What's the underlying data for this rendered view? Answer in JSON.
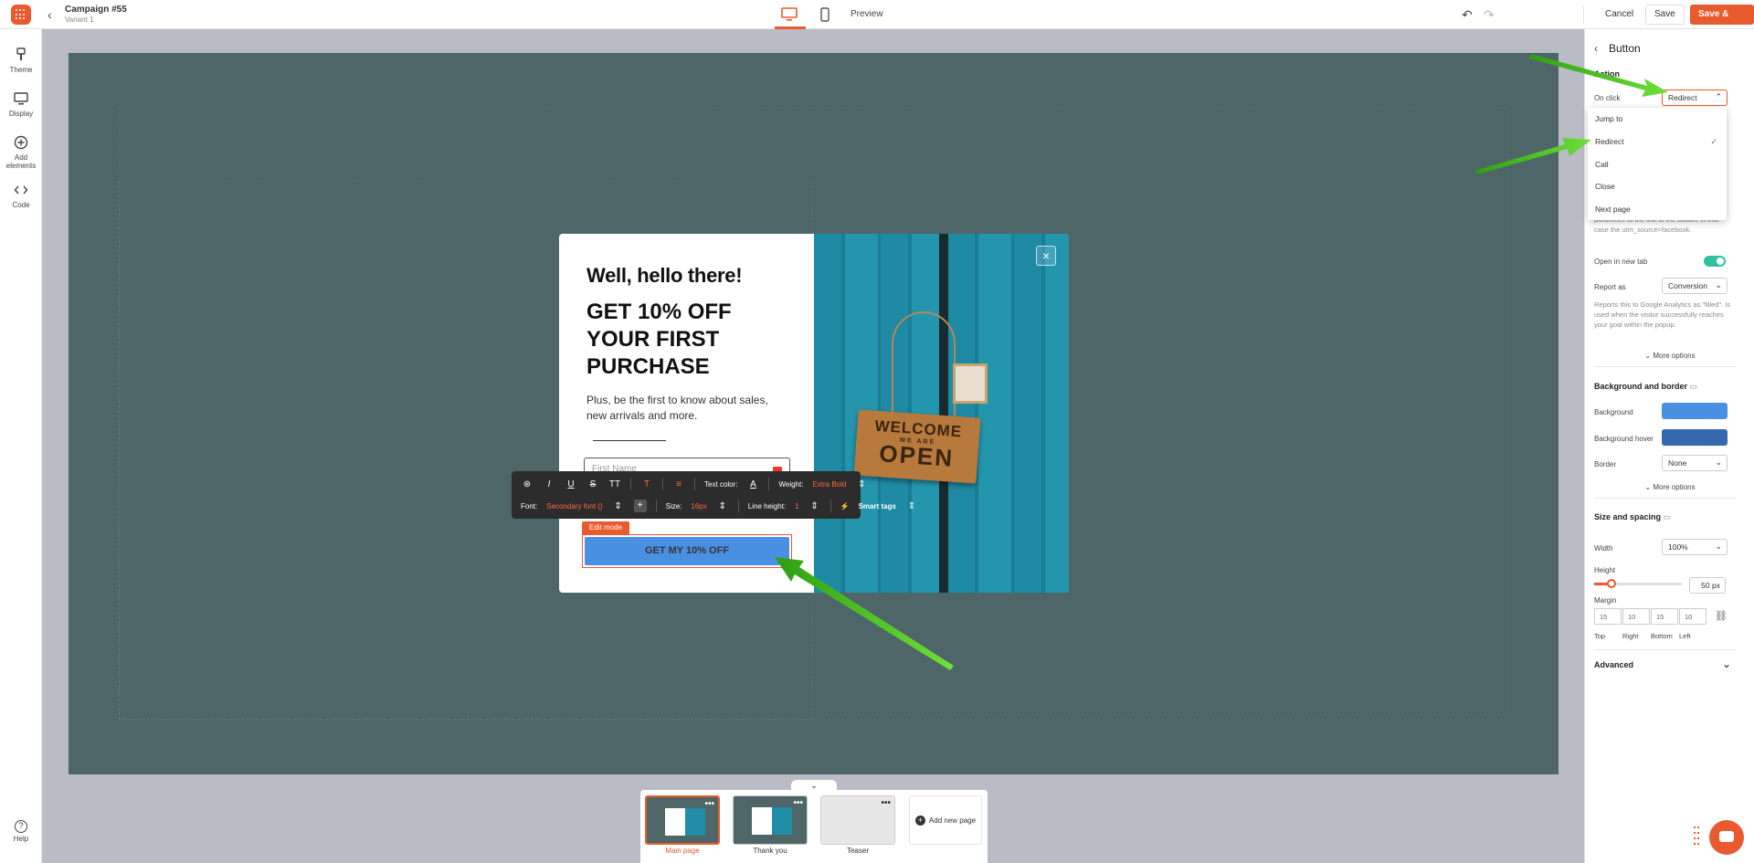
{
  "header": {
    "campaign_title": "Campaign #55",
    "variant": "Variant 1",
    "preview_label": "Preview",
    "cancel_label": "Cancel",
    "save_label": "Save",
    "save_exit_label": "Save & Exit"
  },
  "sidebar": {
    "items": [
      {
        "label": "Theme",
        "icon": "theme-icon"
      },
      {
        "label": "Display",
        "icon": "display-icon"
      },
      {
        "label": "Add elements",
        "icon": "add-elements-icon"
      },
      {
        "label": "Code",
        "icon": "code-icon"
      }
    ],
    "help_label": "Help"
  },
  "popup": {
    "heading": "Well, hello there!",
    "offer_lines": [
      "GET 10% OFF",
      "YOUR FIRST",
      "PURCHASE"
    ],
    "subtext": "Plus, be the first to know about sales, new arrivals and more.",
    "field_placeholder": "First Name",
    "edit_mode_label": "Edit mode",
    "cta_label": "GET MY 10% OFF",
    "sign_text_1": "WELCOME",
    "sign_text_2": "WE ARE",
    "sign_text_3": "OPEN",
    "close_symbol": "×"
  },
  "text_toolbar": {
    "text_color_label": "Text color:",
    "weight_label": "Weight:",
    "weight_value": "Extra Bold",
    "font_label": "Font:",
    "font_value": "Secondary font ()",
    "size_label": "Size:",
    "size_value": "16px",
    "line_height_label": "Line height:",
    "line_height_value": "1",
    "smart_tags_label": "Smart tags"
  },
  "pages": {
    "toggle_symbol": "⌄",
    "items": [
      {
        "label": "Main page",
        "active": true
      },
      {
        "label": "Thank you",
        "active": false
      },
      {
        "label": "Teaser",
        "active": false
      }
    ],
    "add_label": "Add new page"
  },
  "right_panel": {
    "title": "Button",
    "section_label": "Action",
    "on_click_label": "On click",
    "on_click_value": "Redirect",
    "dropdown_options": [
      "Jump to",
      "Redirect",
      "Call",
      "Close",
      "Next page"
    ],
    "dropdown_selected": "Redirect",
    "link_help": "parameter to the link of the button, in this case the utm_source=facebook.",
    "open_new_tab_label": "Open in new tab",
    "open_new_tab_on": true,
    "report_as_label": "Report as",
    "report_as_value": "Conversion",
    "report_help": "Reports this to Google Analytics as \"filled\". Is used when the visitor successfully reaches your goal within the popup.",
    "more_options_label": "More options",
    "bg_border_heading": "Background and border",
    "background_label": "Background",
    "background_color": "#4a90e2",
    "background_hover_label": "Background hover",
    "background_hover_color": "#3568ad",
    "border_label": "Border",
    "border_value": "None",
    "size_spacing_heading": "Size and spacing",
    "width_label": "Width",
    "width_value": "100%",
    "height_label": "Height",
    "height_value": "50",
    "height_unit": "px",
    "margin_label": "Margin",
    "margin_values": [
      "15",
      "10",
      "15",
      "10"
    ],
    "margin_labels": [
      "Top",
      "Right",
      "Bottom",
      "Left"
    ],
    "advanced_label": "Advanced"
  },
  "colors": {
    "accent": "#ea5a2f",
    "stage": "#4e6668",
    "cta": "#4a90e2",
    "toggle_on": "#2ec39e"
  }
}
